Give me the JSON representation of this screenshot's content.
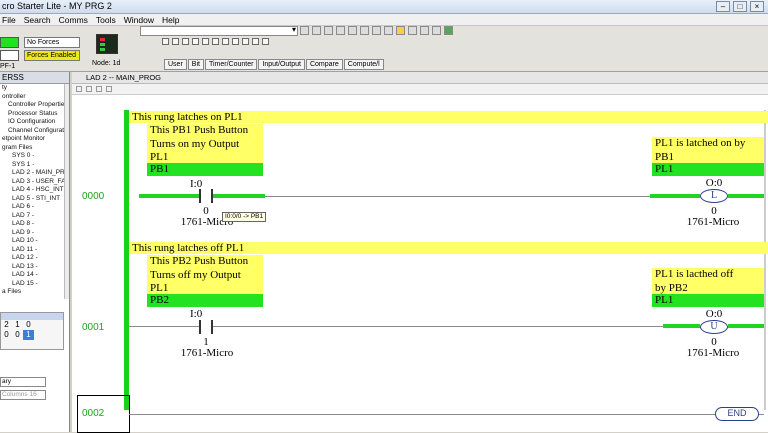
{
  "window": {
    "title": "cro Starter Lite - MY PRG 2"
  },
  "menu": [
    "File",
    "Search",
    "Comms",
    "Tools",
    "Window",
    "Help"
  ],
  "toolbar": {
    "forces": "No Forces",
    "forces_enabled": "Forces Enabled",
    "node_label": "Node: 1d",
    "mode_label": "",
    "rs_label": "PF-1"
  },
  "tabs": [
    "User",
    "Bit",
    "Timer/Counter",
    "Input/Output",
    "Compare",
    "Compute/l"
  ],
  "left_panel": {
    "header": "ERSS",
    "tree": [
      {
        "label": "ty",
        "level": 0
      },
      {
        "label": "ontroller",
        "level": 0
      },
      {
        "label": "Controller Properties",
        "level": 1
      },
      {
        "label": "Processor Status",
        "level": 1
      },
      {
        "label": "IO Configuration",
        "level": 1
      },
      {
        "label": "Channel Configuration",
        "level": 1
      },
      {
        "label": "etpoint Monitor",
        "level": 0
      },
      {
        "label": "gram Files",
        "level": 0
      },
      {
        "label": "SYS 0 -",
        "level": 2
      },
      {
        "label": "SYS 1 -",
        "level": 2
      },
      {
        "label": "LAD 2 - MAIN_PROG",
        "level": 2
      },
      {
        "label": "LAD 3 - USER_FAULT",
        "level": 2
      },
      {
        "label": "LAD 4 - HSC_INT",
        "level": 2
      },
      {
        "label": "LAD 5 - STI_INT",
        "level": 2
      },
      {
        "label": "LAD 6 -",
        "level": 2
      },
      {
        "label": "LAD 7 -",
        "level": 2
      },
      {
        "label": "LAD 8 -",
        "level": 2
      },
      {
        "label": "LAD 9 -",
        "level": 2
      },
      {
        "label": "LAD 10 -",
        "level": 2
      },
      {
        "label": "LAD 11 -",
        "level": 2
      },
      {
        "label": "LAD 12 -",
        "level": 2
      },
      {
        "label": "LAD 13 -",
        "level": 2
      },
      {
        "label": "LAD 14 -",
        "level": 2
      },
      {
        "label": "LAD 15 -",
        "level": 2
      },
      {
        "label": "a Files",
        "level": 0
      }
    ],
    "bits_header": [
      "2",
      "1",
      "0"
    ],
    "bits_values": [
      "0",
      "0",
      "1"
    ],
    "combo1": "ary",
    "combo2": "Columns 16"
  },
  "main": {
    "tab_title": "LAD 2 -- MAIN_PROG",
    "rungs": [
      {
        "number": "0000",
        "comment": "This rung latches on PL1",
        "contact_desc": [
          "This PB1 Push Button",
          "Turns on my Output",
          "PL1"
        ],
        "contact_symbol": "PB1",
        "contact_addr": "I:0",
        "contact_bit": "0",
        "contact_platform": "1761-Micro",
        "coil_desc": [
          "PL1 is latched on by",
          "PB1"
        ],
        "coil_symbol": "PL1",
        "coil_addr": "O:0",
        "coil_type": "L",
        "coil_bit": "0",
        "coil_platform": "1761-Micro",
        "tooltip": "I0:0/0 -> PB1"
      },
      {
        "number": "0001",
        "comment": "This rung latches off PL1",
        "contact_desc": [
          "This PB2 Push Button",
          "Turns off my Output",
          "PL1"
        ],
        "contact_symbol": "PB2",
        "contact_addr": "I:0",
        "contact_bit": "1",
        "contact_platform": "1761-Micro",
        "coil_desc": [
          "PL1 is lacthed off",
          "by PB2"
        ],
        "coil_symbol": "PL1",
        "coil_addr": "O:0",
        "coil_type": "U",
        "coil_bit": "0",
        "coil_platform": "1761-Micro"
      },
      {
        "number": "0002",
        "end_label": "END"
      }
    ]
  }
}
